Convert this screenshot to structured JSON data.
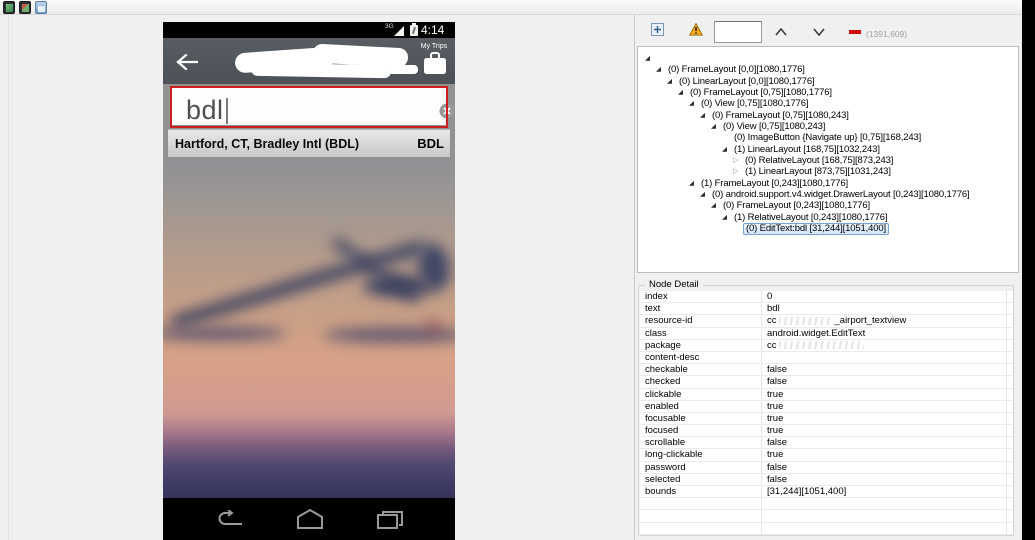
{
  "main_toolbar": {
    "icons": [
      "device-screenshot",
      "device-screenshot-compressed",
      "save-screenshot"
    ]
  },
  "phone": {
    "status_bar": {
      "network": "3G",
      "time": "4:14"
    },
    "app_bar": {
      "my_trips_label": "My Trips"
    },
    "search_field": {
      "value": "bdl"
    },
    "result": {
      "title": "Hartford, CT, Bradley Intl (BDL)",
      "code": "BDL"
    }
  },
  "tree_panel": {
    "toolbar": {
      "search_value": "",
      "coords_readout": "(1391,609)"
    },
    "nodes": [
      {
        "level": 0,
        "state": "expanded",
        "label": ""
      },
      {
        "level": 1,
        "state": "expanded",
        "label": "(0) FrameLayout [0,0][1080,1776]"
      },
      {
        "level": 2,
        "state": "expanded",
        "label": "(0) LinearLayout [0,0][1080,1776]"
      },
      {
        "level": 3,
        "state": "expanded",
        "label": "(0) FrameLayout [0,75][1080,1776]"
      },
      {
        "level": 4,
        "state": "expanded",
        "label": "(0) View [0,75][1080,1776]"
      },
      {
        "level": 5,
        "state": "expanded",
        "label": "(0) FrameLayout [0,75][1080,243]"
      },
      {
        "level": 6,
        "state": "expanded",
        "label": "(0) View [0,75][1080,243]"
      },
      {
        "level": 7,
        "state": "leaf",
        "label": "(0) ImageButton {Navigate up} [0,75][168,243]"
      },
      {
        "level": 7,
        "state": "expanded",
        "label": "(1) LinearLayout [168,75][1032,243]"
      },
      {
        "level": 8,
        "state": "collapsed",
        "label": "(0) RelativeLayout [168,75][873,243]"
      },
      {
        "level": 8,
        "state": "collapsed",
        "label": "(1) LinearLayout [873,75][1031,243]"
      },
      {
        "level": 4,
        "state": "expanded",
        "label": "(1) FrameLayout [0,243][1080,1776]"
      },
      {
        "level": 5,
        "state": "expanded",
        "label": "(0) android.support.v4.widget.DrawerLayout [0,243][1080,1776]"
      },
      {
        "level": 6,
        "state": "expanded",
        "label": "(0) FrameLayout [0,243][1080,1776]"
      },
      {
        "level": 7,
        "state": "expanded",
        "label": "(1) RelativeLayout [0,243][1080,1776]"
      },
      {
        "level": 8,
        "state": "leaf",
        "selected": true,
        "label": "(0) EditText:bdl [31,244][1051,400]"
      }
    ]
  },
  "node_detail": {
    "title": "Node Detail",
    "rows": [
      {
        "k": "index",
        "v": "0"
      },
      {
        "k": "text",
        "v": "bdl"
      },
      {
        "k": "resource-id",
        "redacted": true,
        "v_prefix": "cc",
        "smudge_width": 54,
        "v_suffix": "_airport_textview"
      },
      {
        "k": "class",
        "v": "android.widget.EditText"
      },
      {
        "k": "package",
        "redacted": true,
        "v_prefix": "cc",
        "smudge_width": 85,
        "v_suffix": ""
      },
      {
        "k": "content-desc",
        "v": ""
      },
      {
        "k": "checkable",
        "v": "false"
      },
      {
        "k": "checked",
        "v": "false"
      },
      {
        "k": "clickable",
        "v": "true"
      },
      {
        "k": "enabled",
        "v": "true"
      },
      {
        "k": "focusable",
        "v": "true"
      },
      {
        "k": "focused",
        "v": "true"
      },
      {
        "k": "scrollable",
        "v": "false"
      },
      {
        "k": "long-clickable",
        "v": "true"
      },
      {
        "k": "password",
        "v": "false"
      },
      {
        "k": "selected",
        "v": "false"
      },
      {
        "k": "bounds",
        "v": "[31,244][1051,400]"
      },
      {
        "k": "",
        "v": ""
      },
      {
        "k": "",
        "v": ""
      },
      {
        "k": "",
        "v": ""
      }
    ]
  },
  "colors": {
    "highlight_red": "#cb1e1e",
    "selection_blue": "#7da2ce",
    "warning_orange": "#f6a821",
    "appbar_gray": "#52575d"
  }
}
